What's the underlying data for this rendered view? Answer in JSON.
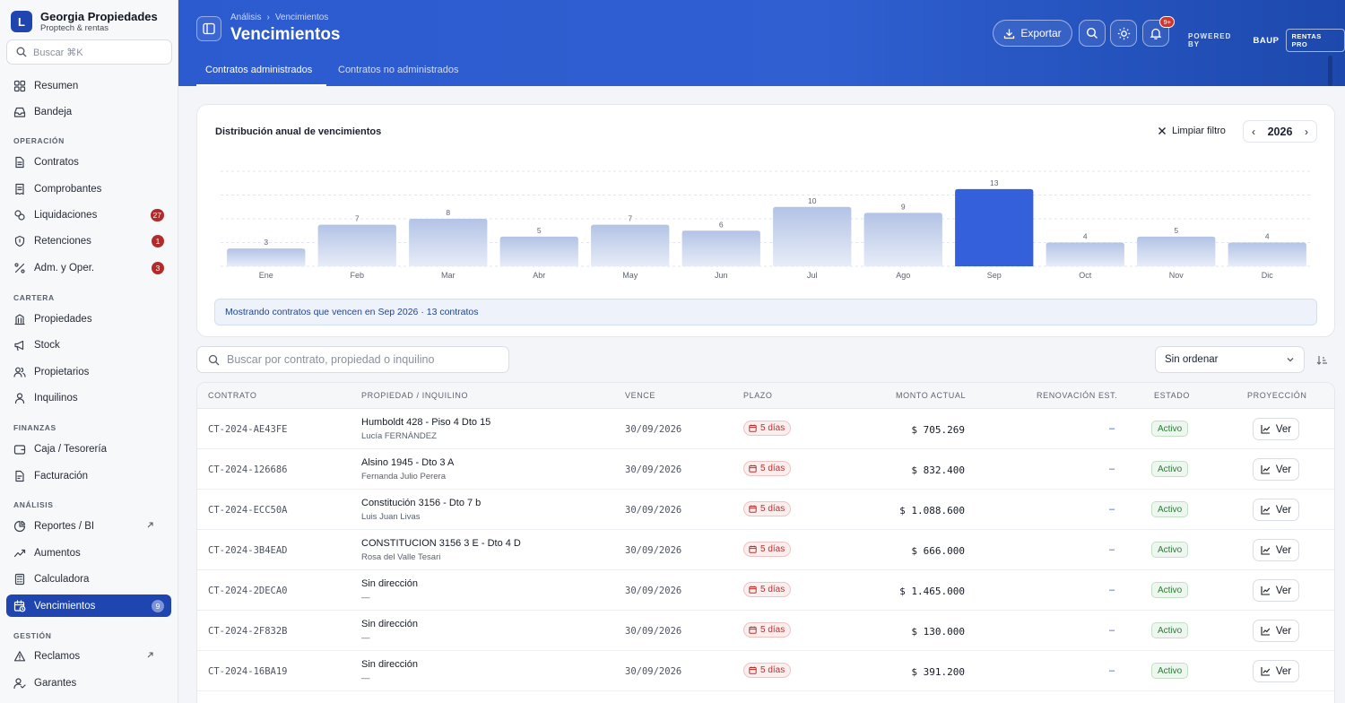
{
  "brand": {
    "logo_letter": "L",
    "name": "Georgia Propiedades",
    "subtitle": "Proptech & rentas"
  },
  "sidebar": {
    "search_placeholder": "Buscar ⌘K",
    "top_items": [
      {
        "label": "Resumen",
        "icon": "grid-icon"
      },
      {
        "label": "Bandeja",
        "icon": "inbox-icon"
      }
    ],
    "sections": [
      {
        "title": "OPERACIÓN",
        "items": [
          {
            "label": "Contratos",
            "icon": "file-icon"
          },
          {
            "label": "Comprobantes",
            "icon": "receipt-icon"
          },
          {
            "label": "Liquidaciones",
            "icon": "coins-icon",
            "badge": "27"
          },
          {
            "label": "Retenciones",
            "icon": "shield-icon",
            "badge": "1"
          },
          {
            "label": "Adm. y Oper.",
            "icon": "percent-icon",
            "badge": "3"
          }
        ]
      },
      {
        "title": "CARTERA",
        "items": [
          {
            "label": "Propiedades",
            "icon": "building-icon"
          },
          {
            "label": "Stock",
            "icon": "megaphone-icon"
          },
          {
            "label": "Propietarios",
            "icon": "users-icon"
          },
          {
            "label": "Inquilinos",
            "icon": "user-icon"
          }
        ]
      },
      {
        "title": "FINANZAS",
        "items": [
          {
            "label": "Caja / Tesorería",
            "icon": "wallet-icon"
          },
          {
            "label": "Facturación",
            "icon": "invoice-icon"
          }
        ]
      },
      {
        "title": "ANÁLISIS",
        "items": [
          {
            "label": "Reportes / BI",
            "icon": "pie-icon",
            "external": true
          },
          {
            "label": "Aumentos",
            "icon": "trend-icon"
          },
          {
            "label": "Calculadora",
            "icon": "calculator-icon"
          },
          {
            "label": "Vencimientos",
            "icon": "calendar-clock-icon",
            "badge": "9",
            "active": true
          }
        ]
      },
      {
        "title": "GESTIÓN",
        "items": [
          {
            "label": "Reclamos",
            "icon": "alert-icon",
            "external": true
          },
          {
            "label": "Garantes",
            "icon": "user-check-icon"
          }
        ]
      }
    ]
  },
  "header": {
    "breadcrumb": [
      "Análisis",
      "Vencimientos"
    ],
    "title": "Vencimientos",
    "export_label": "Exportar",
    "notifications_badge": "9+",
    "powered_by": "POWERED BY",
    "powered_brand": "BAUP",
    "powered_product": "RENTAS PRO",
    "tabs": [
      "Contratos administrados",
      "Contratos no administrados"
    ]
  },
  "chart_card": {
    "title": "Distribución anual de vencimientos",
    "clear_filter": "Limpiar filtro",
    "year": "2026",
    "prev": "‹",
    "next": "›",
    "info": "Mostrando contratos que vencen en Sep 2026 · 13 contratos"
  },
  "chart_data": {
    "type": "bar",
    "categories": [
      "Ene",
      "Feb",
      "Mar",
      "Abr",
      "May",
      "Jun",
      "Jul",
      "Ago",
      "Sep",
      "Oct",
      "Nov",
      "Dic"
    ],
    "values": [
      3,
      7,
      8,
      5,
      7,
      6,
      10,
      9,
      13,
      4,
      5,
      4
    ],
    "selected_index": 8,
    "ylim": [
      0,
      16
    ],
    "grid": true,
    "colors": {
      "bar_top": "#b3c3e6",
      "bar_bottom": "#e7ecf7",
      "selected": "#3560dc"
    }
  },
  "filters": {
    "search_placeholder": "Buscar por contrato, propiedad o inquilino",
    "sort_value": "Sin ordenar"
  },
  "table": {
    "headers": [
      "CONTRATO",
      "PROPIEDAD / INQUILINO",
      "VENCE",
      "PLAZO",
      "MONTO ACTUAL",
      "RENOVACIÓN EST.",
      "ESTADO",
      "PROYECCIÓN"
    ],
    "rows": [
      {
        "contract": "CT-2024-AE43FE",
        "property": "Humboldt 428 - Piso 4 Dto 15",
        "tenant": "Lucía FERNÁNDEZ",
        "due": "30/09/2026",
        "term": "5 días",
        "amount": "$ 705.269",
        "renewal": "–",
        "status": "Activo",
        "action": "Ver"
      },
      {
        "contract": "CT-2024-126686",
        "property": "Alsino 1945 - Dto 3 A",
        "tenant": "Fernanda Julio Perera",
        "due": "30/09/2026",
        "term": "5 días",
        "amount": "$ 832.400",
        "renewal": "–",
        "status": "Activo",
        "action": "Ver"
      },
      {
        "contract": "CT-2024-ECC50A",
        "property": "Constitución 3156 - Dto 7 b",
        "tenant": "Luis Juan Livas",
        "due": "30/09/2026",
        "term": "5 días",
        "amount": "$ 1.088.600",
        "renewal": "–",
        "status": "Activo",
        "action": "Ver"
      },
      {
        "contract": "CT-2024-3B4EAD",
        "property": "CONSTITUCION 3156 3 E - Dto 4 D",
        "tenant": "Rosa del Valle Tesari",
        "due": "30/09/2026",
        "term": "5 días",
        "amount": "$ 666.000",
        "renewal": "–",
        "status": "Activo",
        "action": "Ver"
      },
      {
        "contract": "CT-2024-2DECA0",
        "property": "Sin dirección",
        "tenant": "—",
        "due": "30/09/2026",
        "term": "5 días",
        "amount": "$ 1.465.000",
        "renewal": "–",
        "status": "Activo",
        "action": "Ver"
      },
      {
        "contract": "CT-2024-2F832B",
        "property": "Sin dirección",
        "tenant": "—",
        "due": "30/09/2026",
        "term": "5 días",
        "amount": "$ 130.000",
        "renewal": "–",
        "status": "Activo",
        "action": "Ver"
      },
      {
        "contract": "CT-2024-16BA19",
        "property": "Sin dirección",
        "tenant": "—",
        "due": "30/09/2026",
        "term": "5 días",
        "amount": "$ 391.200",
        "renewal": "–",
        "status": "Activo",
        "action": "Ver"
      }
    ]
  }
}
